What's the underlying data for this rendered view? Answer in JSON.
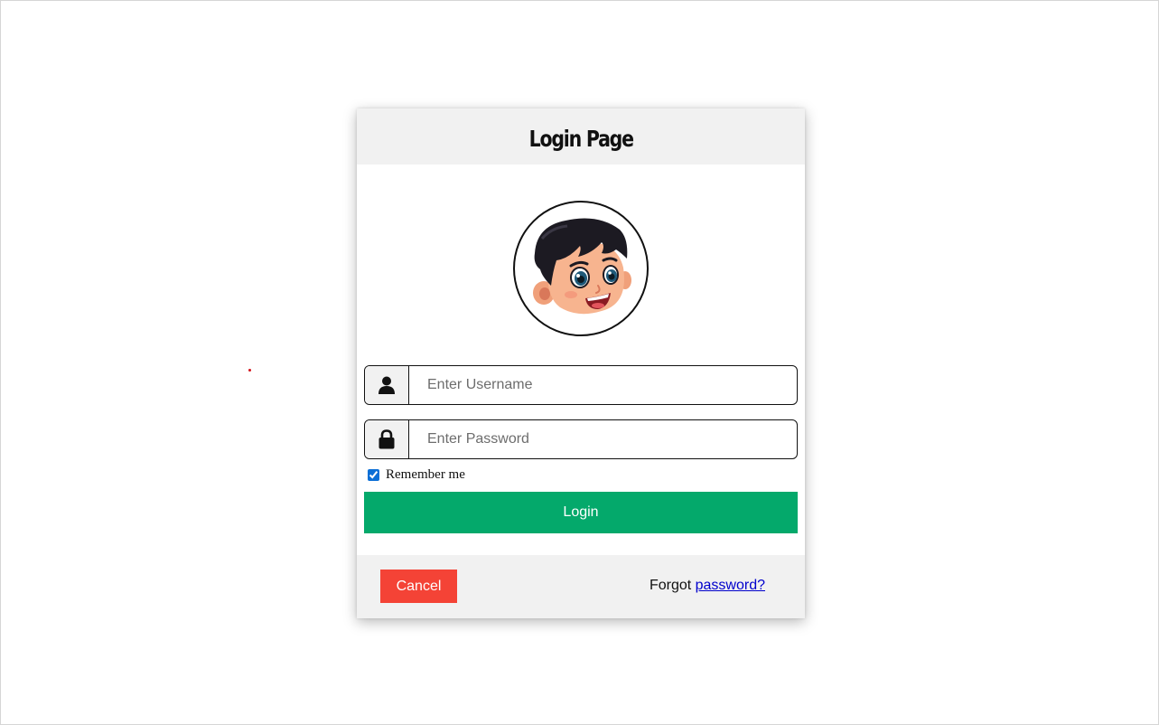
{
  "page": {
    "title": "Login Page"
  },
  "avatar": {
    "icon": "cartoon-boy-avatar"
  },
  "username": {
    "icon": "user-icon",
    "placeholder": "Enter Username",
    "value": ""
  },
  "password": {
    "icon": "lock-icon",
    "placeholder": "Enter Password",
    "value": ""
  },
  "remember": {
    "label": "Remember me",
    "checked": true
  },
  "login_button": {
    "label": "Login"
  },
  "footer": {
    "cancel_label": "Cancel",
    "forgot_prefix": "Forgot ",
    "forgot_link": "password?"
  },
  "colors": {
    "login_button": "#04a96b",
    "cancel_button": "#f44336",
    "link": "#0000cc",
    "header_bg": "#f1f1f1"
  }
}
